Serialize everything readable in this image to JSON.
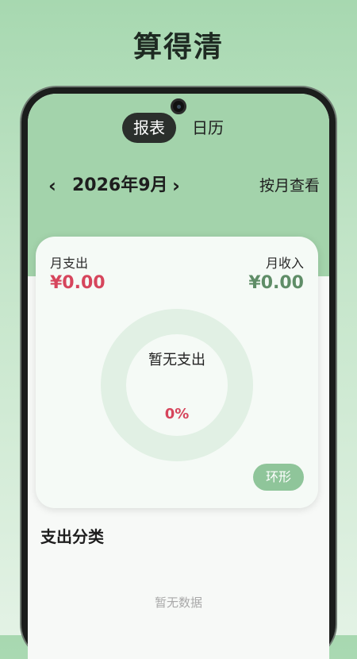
{
  "app": {
    "title": "算得清"
  },
  "tabs": [
    {
      "label": "报表",
      "active": true
    },
    {
      "label": "日历",
      "active": false
    }
  ],
  "period": {
    "prev_icon": "chevron-left",
    "next_icon": "chevron-right",
    "prev_glyph": "‹",
    "next_glyph": "›",
    "label": "2026年9月",
    "view_mode": "按月查看"
  },
  "summary": {
    "expense_label": "月支出",
    "expense_value": "¥0.00",
    "income_label": "月收入",
    "income_value": "¥0.00",
    "donut_label": "暂无支出",
    "donut_percent": "0%",
    "chart_toggle": "环形"
  },
  "category": {
    "title": "支出分类",
    "empty_text": "暂无数据"
  },
  "colors": {
    "accent_green": "#a3d3ab",
    "expense_red": "#d6455c",
    "income_green": "#5f8d67"
  }
}
